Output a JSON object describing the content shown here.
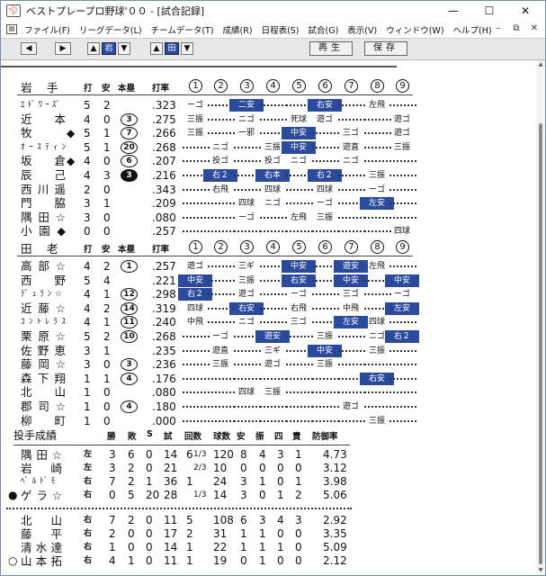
{
  "window": {
    "title": "ベストプレープロ野球'００ - [試合記録]",
    "app_icon": "baseball-app-icon"
  },
  "menu": [
    "ファイル(F)",
    "リーグデータ(L)",
    "チームデータ(T)",
    "成績(R)",
    "日程表(S)",
    "試合(G)",
    "表示(V)",
    "ウィンドウ(W)",
    "ヘルプ(H)"
  ],
  "toolbar": {
    "team1": "岩",
    "team2": "田",
    "play": "再生",
    "save": "保存"
  },
  "innings": [
    "1",
    "2",
    "3",
    "4",
    "5",
    "6",
    "7",
    "8",
    "9"
  ],
  "team1": {
    "name": "岩　手",
    "cols": [
      "打",
      "安",
      "本塁",
      "打率"
    ],
    "rows": [
      {
        "name": "ｴﾄﾞﾜｰｽﾞ",
        "small": true,
        "mark": "",
        "ab": "5",
        "h": "2",
        "hr": "",
        "avg": ".323",
        "res": [
          [
            "ーゴ",
            0
          ],
          [
            "",
            "d"
          ],
          [
            "二安",
            1
          ],
          [
            "",
            "d"
          ],
          [
            "",
            "d"
          ],
          [
            "右安",
            1
          ],
          [
            "",
            "d"
          ],
          [
            "左飛",
            0
          ],
          [
            "",
            "d"
          ]
        ]
      },
      {
        "name": "近　本",
        "mark": "",
        "ab": "4",
        "h": "0",
        "hr": "3",
        "avg": ".275",
        "res": [
          [
            "三振",
            0
          ],
          [
            "",
            "d"
          ],
          [
            "ニゴ",
            0
          ],
          [
            "",
            "d"
          ],
          [
            "死球",
            0
          ],
          [
            "遊ゴ",
            0
          ],
          [
            "",
            "d"
          ],
          [
            "",
            "d"
          ],
          [
            "遊ゴ",
            0
          ]
        ]
      },
      {
        "name": "牧",
        "mark": "◆",
        "ab": "5",
        "h": "1",
        "hr": "7",
        "avg": ".266",
        "res": [
          [
            "三振",
            0
          ],
          [
            "",
            "d"
          ],
          [
            "一邪",
            0
          ],
          [
            "",
            "d"
          ],
          [
            "中安",
            1
          ],
          [
            "",
            "d"
          ],
          [
            "三ゴ",
            0
          ],
          [
            "",
            "d"
          ],
          [
            "遊ゴ",
            0
          ]
        ]
      },
      {
        "name": "ｵｰｽﾃｨﾝ",
        "small": true,
        "mark": "",
        "ab": "5",
        "h": "1",
        "hr": "20",
        "avg": ".268",
        "res": [
          [
            "",
            "d"
          ],
          [
            "ニゴ",
            0
          ],
          [
            "",
            "d"
          ],
          [
            "三振",
            0
          ],
          [
            "中安",
            1
          ],
          [
            "",
            "d"
          ],
          [
            "遊直",
            0
          ],
          [
            "",
            "d"
          ],
          [
            "三振",
            0
          ]
        ]
      },
      {
        "name": "坂倉",
        "mark": "◆",
        "ab": "4",
        "h": "0",
        "hr": "6",
        "avg": ".207",
        "res": [
          [
            "",
            "d"
          ],
          [
            "投ゴ",
            0
          ],
          [
            "",
            "d"
          ],
          [
            "投ゴ",
            0
          ],
          [
            "ニゴ",
            0
          ],
          [
            "",
            "d"
          ],
          [
            "ニゴ",
            0
          ],
          [
            "",
            "d"
          ],
          [
            "",
            "d"
          ]
        ]
      },
      {
        "name": "辰　己",
        "mark": "",
        "ab": "4",
        "h": "3",
        "hr": "3",
        "hrfill": true,
        "avg": ".216",
        "res": [
          [
            "",
            "d"
          ],
          [
            "右２",
            1
          ],
          [
            "",
            "d"
          ],
          [
            "右本",
            1
          ],
          [
            "",
            "d"
          ],
          [
            "右２",
            1
          ],
          [
            "",
            "d"
          ],
          [
            "三振",
            0
          ],
          [
            "",
            "d"
          ]
        ]
      },
      {
        "name": "西川遥",
        "mark": "",
        "ab": "2",
        "h": "0",
        "hr": "",
        "avg": ".343",
        "res": [
          [
            "",
            "d"
          ],
          [
            "右飛",
            0
          ],
          [
            "",
            "d"
          ],
          [
            "四球",
            0
          ],
          [
            "",
            "d"
          ],
          [
            "四球",
            0
          ],
          [
            "",
            "d"
          ],
          [
            "ーゴ",
            0
          ],
          [
            "",
            "d"
          ]
        ]
      },
      {
        "name": "門　脇",
        "mark": "",
        "ab": "3",
        "h": "1",
        "hr": "",
        "avg": ".209",
        "res": [
          [
            "",
            "d"
          ],
          [
            "",
            "d"
          ],
          [
            "四球",
            0
          ],
          [
            "ニゴ",
            0
          ],
          [
            "",
            "d"
          ],
          [
            "ーゴ",
            0
          ],
          [
            "",
            "d"
          ],
          [
            "左安",
            1
          ],
          [
            "",
            "d"
          ]
        ]
      },
      {
        "name": "隅田☆",
        "mark": "",
        "ab": "3",
        "h": "0",
        "hr": "",
        "avg": ".080",
        "res": [
          [
            "",
            "d"
          ],
          [
            "",
            "d"
          ],
          [
            "ーゴ",
            0
          ],
          [
            "",
            "d"
          ],
          [
            "左飛",
            0
          ],
          [
            "三振",
            0
          ],
          [
            "",
            "d"
          ],
          [
            "",
            "d"
          ],
          [
            "",
            "d"
          ]
        ]
      },
      {
        "name": "小園◆",
        "mark": "",
        "ab": "0",
        "h": "0",
        "hr": "",
        "avg": ".257",
        "res": [
          [
            "",
            "d"
          ],
          [
            "",
            "d"
          ],
          [
            "",
            "d"
          ],
          [
            "",
            "d"
          ],
          [
            "",
            "d"
          ],
          [
            "",
            "d"
          ],
          [
            "",
            "d"
          ],
          [
            "",
            "d"
          ],
          [
            "四球",
            0
          ]
        ]
      }
    ]
  },
  "team2": {
    "name": "田　老",
    "cols": [
      "打",
      "安",
      "本塁",
      "打率"
    ],
    "rows": [
      {
        "name": "高部☆",
        "mark": "",
        "ab": "4",
        "h": "2",
        "hr": "1",
        "avg": ".257",
        "res": [
          [
            "遊ゴ",
            0
          ],
          [
            "",
            "d"
          ],
          [
            "三ギ",
            0
          ],
          [
            "",
            "d"
          ],
          [
            "中安",
            1
          ],
          [
            "",
            "d"
          ],
          [
            "遊安",
            1
          ],
          [
            "左飛",
            0
          ],
          [
            "",
            "d"
          ]
        ]
      },
      {
        "name": "西　野",
        "mark": "",
        "ab": "5",
        "h": "4",
        "hr": "",
        "avg": ".221",
        "res": [
          [
            "中安",
            1
          ],
          [
            "",
            "d"
          ],
          [
            "三振",
            0
          ],
          [
            "",
            "d"
          ],
          [
            "右安",
            1
          ],
          [
            "",
            "d"
          ],
          [
            "中安",
            1
          ],
          [
            "",
            "d"
          ],
          [
            "中安",
            1
          ]
        ]
      },
      {
        "name": "ﾃﾞｭﾗﾝ☆",
        "small": true,
        "mark": "",
        "ab": "4",
        "h": "1",
        "hr": "12",
        "avg": ".298",
        "res": [
          [
            "右２",
            1
          ],
          [
            "",
            "d"
          ],
          [
            "遊ゴ",
            0
          ],
          [
            "",
            "d"
          ],
          [
            "ーゴ",
            0
          ],
          [
            "",
            "d"
          ],
          [
            "三ゴ",
            0
          ],
          [
            "",
            "d"
          ],
          [
            "ーゴ",
            0
          ]
        ]
      },
      {
        "name": "近藤☆",
        "mark": "",
        "ab": "4",
        "h": "2",
        "hr": "14",
        "avg": ".319",
        "res": [
          [
            "四球",
            0
          ],
          [
            "",
            "d"
          ],
          [
            "右安",
            1
          ],
          [
            "",
            "d"
          ],
          [
            "右飛",
            0
          ],
          [
            "",
            "d"
          ],
          [
            "中飛",
            0
          ],
          [
            "",
            "d"
          ],
          [
            "左安",
            1
          ]
        ]
      },
      {
        "name": "ｺﾝﾄﾚﾗｽ",
        "small": true,
        "mark": "",
        "ab": "4",
        "h": "1",
        "hr": "11",
        "avg": ".240",
        "res": [
          [
            "中飛",
            0
          ],
          [
            "",
            "d"
          ],
          [
            "ニゴ",
            0
          ],
          [
            "",
            "d"
          ],
          [
            "三ゴ",
            0
          ],
          [
            "",
            "d"
          ],
          [
            "左安",
            1
          ],
          [
            "四球",
            0
          ],
          [
            "",
            "d"
          ]
        ]
      },
      {
        "name": "栗原☆",
        "mark": "",
        "ab": "5",
        "h": "2",
        "hr": "10",
        "avg": ".268",
        "res": [
          [
            "",
            "d"
          ],
          [
            "ーゴ",
            0
          ],
          [
            "",
            "d"
          ],
          [
            "遊安",
            1
          ],
          [
            "",
            "d"
          ],
          [
            "三振",
            0
          ],
          [
            "",
            "d"
          ],
          [
            "ニゴ",
            0
          ],
          [
            "右２",
            1
          ]
        ]
      },
      {
        "name": "佐野恵",
        "mark": "",
        "ab": "3",
        "h": "1",
        "hr": "",
        "avg": ".235",
        "res": [
          [
            "",
            "d"
          ],
          [
            "遊直",
            0
          ],
          [
            "",
            "d"
          ],
          [
            "三ギ",
            0
          ],
          [
            "",
            "d"
          ],
          [
            "中安",
            1
          ],
          [
            "",
            "d"
          ],
          [
            "三振",
            0
          ],
          [
            "",
            "d"
          ]
        ]
      },
      {
        "name": "藤岡☆",
        "mark": "",
        "ab": "3",
        "h": "0",
        "hr": "3",
        "avg": ".236",
        "res": [
          [
            "",
            "d"
          ],
          [
            "三振",
            0
          ],
          [
            "",
            "d"
          ],
          [
            "遊ゴ",
            0
          ],
          [
            "",
            "d"
          ],
          [
            "三振",
            0
          ],
          [
            "",
            "d"
          ],
          [
            "",
            "d"
          ],
          [
            "",
            "d"
          ]
        ]
      },
      {
        "name": "森下翔",
        "mark": "",
        "ab": "1",
        "h": "1",
        "hr": "4",
        "avg": ".176",
        "res": [
          [
            "",
            "d"
          ],
          [
            "",
            "d"
          ],
          [
            "",
            "d"
          ],
          [
            "",
            "d"
          ],
          [
            "",
            "d"
          ],
          [
            "",
            "d"
          ],
          [
            "",
            "d"
          ],
          [
            "右安",
            1
          ],
          [
            "",
            "d"
          ]
        ]
      },
      {
        "name": "北　山",
        "mark": "",
        "ab": "1",
        "h": "0",
        "hr": "",
        "avg": ".080",
        "res": [
          [
            "",
            "d"
          ],
          [
            "",
            "d"
          ],
          [
            "四球",
            0
          ],
          [
            "三振",
            0
          ],
          [
            "",
            "d"
          ],
          [
            "",
            "d"
          ],
          [
            "",
            "d"
          ],
          [
            "",
            "d"
          ],
          [
            "",
            "d"
          ]
        ]
      },
      {
        "name": "郡司☆",
        "mark": "",
        "ab": "1",
        "h": "0",
        "hr": "4",
        "avg": ".180",
        "res": [
          [
            "",
            "d"
          ],
          [
            "",
            "d"
          ],
          [
            "",
            "d"
          ],
          [
            "",
            "d"
          ],
          [
            "",
            "d"
          ],
          [
            "",
            "d"
          ],
          [
            "遊ゴ",
            0
          ],
          [
            "",
            "d"
          ],
          [
            "",
            "d"
          ]
        ]
      },
      {
        "name": "柳　町",
        "mark": "",
        "ab": "1",
        "h": "0",
        "hr": "",
        "avg": ".000",
        "res": [
          [
            "",
            "d"
          ],
          [
            "",
            "d"
          ],
          [
            "",
            "d"
          ],
          [
            "",
            "d"
          ],
          [
            "",
            "d"
          ],
          [
            "",
            "d"
          ],
          [
            "",
            "d"
          ],
          [
            "三振",
            0
          ],
          [
            "",
            "d"
          ]
        ]
      }
    ]
  },
  "pitching": {
    "title": "投手成績",
    "cols": [
      "勝",
      "敗",
      "S",
      "試",
      "回数",
      "球数",
      "安",
      "振",
      "四",
      "責",
      "防御率"
    ],
    "team1": [
      {
        "mark": "",
        "name": "隅田☆",
        "hand": "左",
        "w": "3",
        "l": "6",
        "s": "0",
        "g": "14",
        "ip": "6",
        "frac": "1/3",
        "np": "120",
        "h": "8",
        "k": "4",
        "bb": "3",
        "er": "1",
        "era": "4.73"
      },
      {
        "mark": "",
        "name": "岩　崎",
        "hand": "左",
        "w": "3",
        "l": "2",
        "s": "0",
        "g": "21",
        "ip": "",
        "frac": "2/3",
        "np": "10",
        "h": "0",
        "k": "0",
        "bb": "0",
        "er": "0",
        "era": "3.12"
      },
      {
        "mark": "",
        "name": "ﾍﾞﾙﾄﾞﾓ",
        "small": true,
        "hand": "右",
        "w": "7",
        "l": "2",
        "s": "1",
        "g": "36",
        "ip": "1",
        "frac": "",
        "np": "24",
        "h": "3",
        "k": "1",
        "bb": "0",
        "er": "1",
        "era": "3.98"
      },
      {
        "mark": "●",
        "name": "ゲラ☆",
        "hand": "右",
        "w": "0",
        "l": "5",
        "s": "20",
        "g": "28",
        "ip": "",
        "frac": "1/3",
        "np": "14",
        "h": "3",
        "k": "0",
        "bb": "1",
        "er": "2",
        "era": "5.06"
      }
    ],
    "team2": [
      {
        "mark": "",
        "name": "北　山",
        "hand": "右",
        "w": "7",
        "l": "2",
        "s": "0",
        "g": "11",
        "ip": "5",
        "frac": "",
        "np": "108",
        "h": "6",
        "k": "3",
        "bb": "4",
        "er": "3",
        "era": "2.92"
      },
      {
        "mark": "",
        "name": "藤　平",
        "hand": "右",
        "w": "2",
        "l": "0",
        "s": "0",
        "g": "17",
        "ip": "2",
        "frac": "",
        "np": "31",
        "h": "1",
        "k": "1",
        "bb": "0",
        "er": "0",
        "era": "3.35"
      },
      {
        "mark": "",
        "name": "清水達",
        "hand": "右",
        "w": "1",
        "l": "0",
        "s": "0",
        "g": "14",
        "ip": "1",
        "frac": "",
        "np": "22",
        "h": "1",
        "k": "1",
        "bb": "1",
        "er": "0",
        "era": "5.09"
      },
      {
        "mark": "○",
        "name": "山本拓",
        "hand": "右",
        "w": "4",
        "l": "1",
        "s": "0",
        "g": "11",
        "ip": "1",
        "frac": "",
        "np": "19",
        "h": "0",
        "k": "1",
        "bb": "0",
        "er": "0",
        "era": "2.12"
      }
    ]
  }
}
